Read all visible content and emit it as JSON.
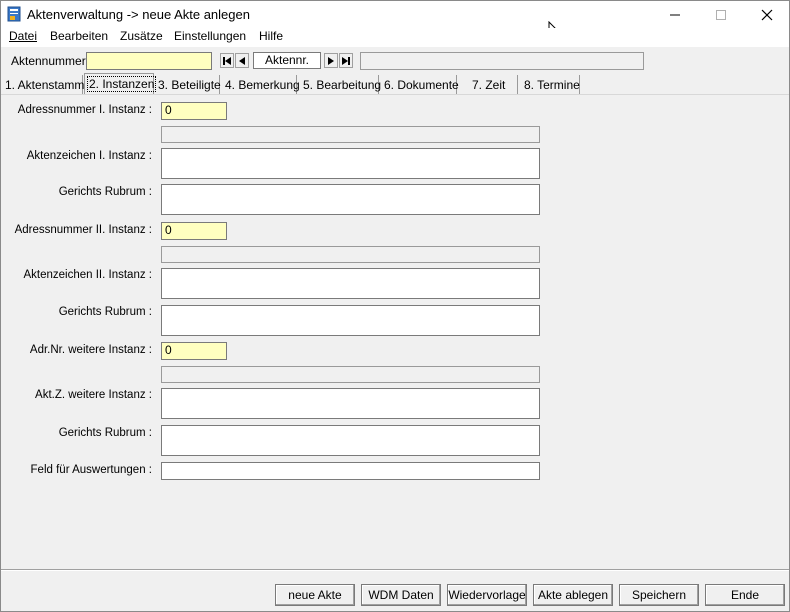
{
  "window": {
    "title": "Aktenverwaltung -> neue Akte anlegen"
  },
  "menu": {
    "items": [
      {
        "label": "Datei"
      },
      {
        "label": "Bearbeiten"
      },
      {
        "label": "Zusätze"
      },
      {
        "label": "Einstellungen"
      },
      {
        "label": "Hilfe"
      }
    ]
  },
  "toolbar": {
    "aktennummer_label": "Aktennummer :",
    "aktennummer_value": "",
    "nav_display": "Aktennr.",
    "info_value": ""
  },
  "tabs": [
    {
      "label": "1. Aktenstamm"
    },
    {
      "label": "2. Instanzen",
      "active": true
    },
    {
      "label": "3. Beteiligte"
    },
    {
      "label": "4. Bemerkung"
    },
    {
      "label": "5. Bearbeitung"
    },
    {
      "label": "6. Dokumente"
    },
    {
      "label": "7. Zeit"
    },
    {
      "label": "8. Termine"
    }
  ],
  "form": {
    "adr1_label": "Adressnummer I. Instanz :",
    "adr1_value": "0",
    "adr1_name": "",
    "az1_label": "Aktenzeichen I. Instanz :",
    "az1_value": "",
    "rubrum1_label": "Gerichts Rubrum :",
    "rubrum1_value": "",
    "adr2_label": "Adressnummer II. Instanz :",
    "adr2_value": "0",
    "adr2_name": "",
    "az2_label": "Aktenzeichen II. Instanz :",
    "az2_value": "",
    "rubrum2_label": "Gerichts Rubrum :",
    "rubrum2_value": "",
    "adr3_label": "Adr.Nr. weitere Instanz :",
    "adr3_value": "0",
    "adr3_name": "",
    "az3_label": "Akt.Z. weitere Instanz :",
    "az3_value": "",
    "rubrum3_label": "Gerichts Rubrum :",
    "rubrum3_value": "",
    "auswertung_label": "Feld für Auswertungen :",
    "auswertung_value": ""
  },
  "buttons": {
    "neue_akte": "neue Akte",
    "wdm_daten": "WDM Daten",
    "wiedervorlage": "Wiedervorlage",
    "akte_ablegen": "Akte ablegen",
    "speichern": "Speichern",
    "ende": "Ende"
  }
}
